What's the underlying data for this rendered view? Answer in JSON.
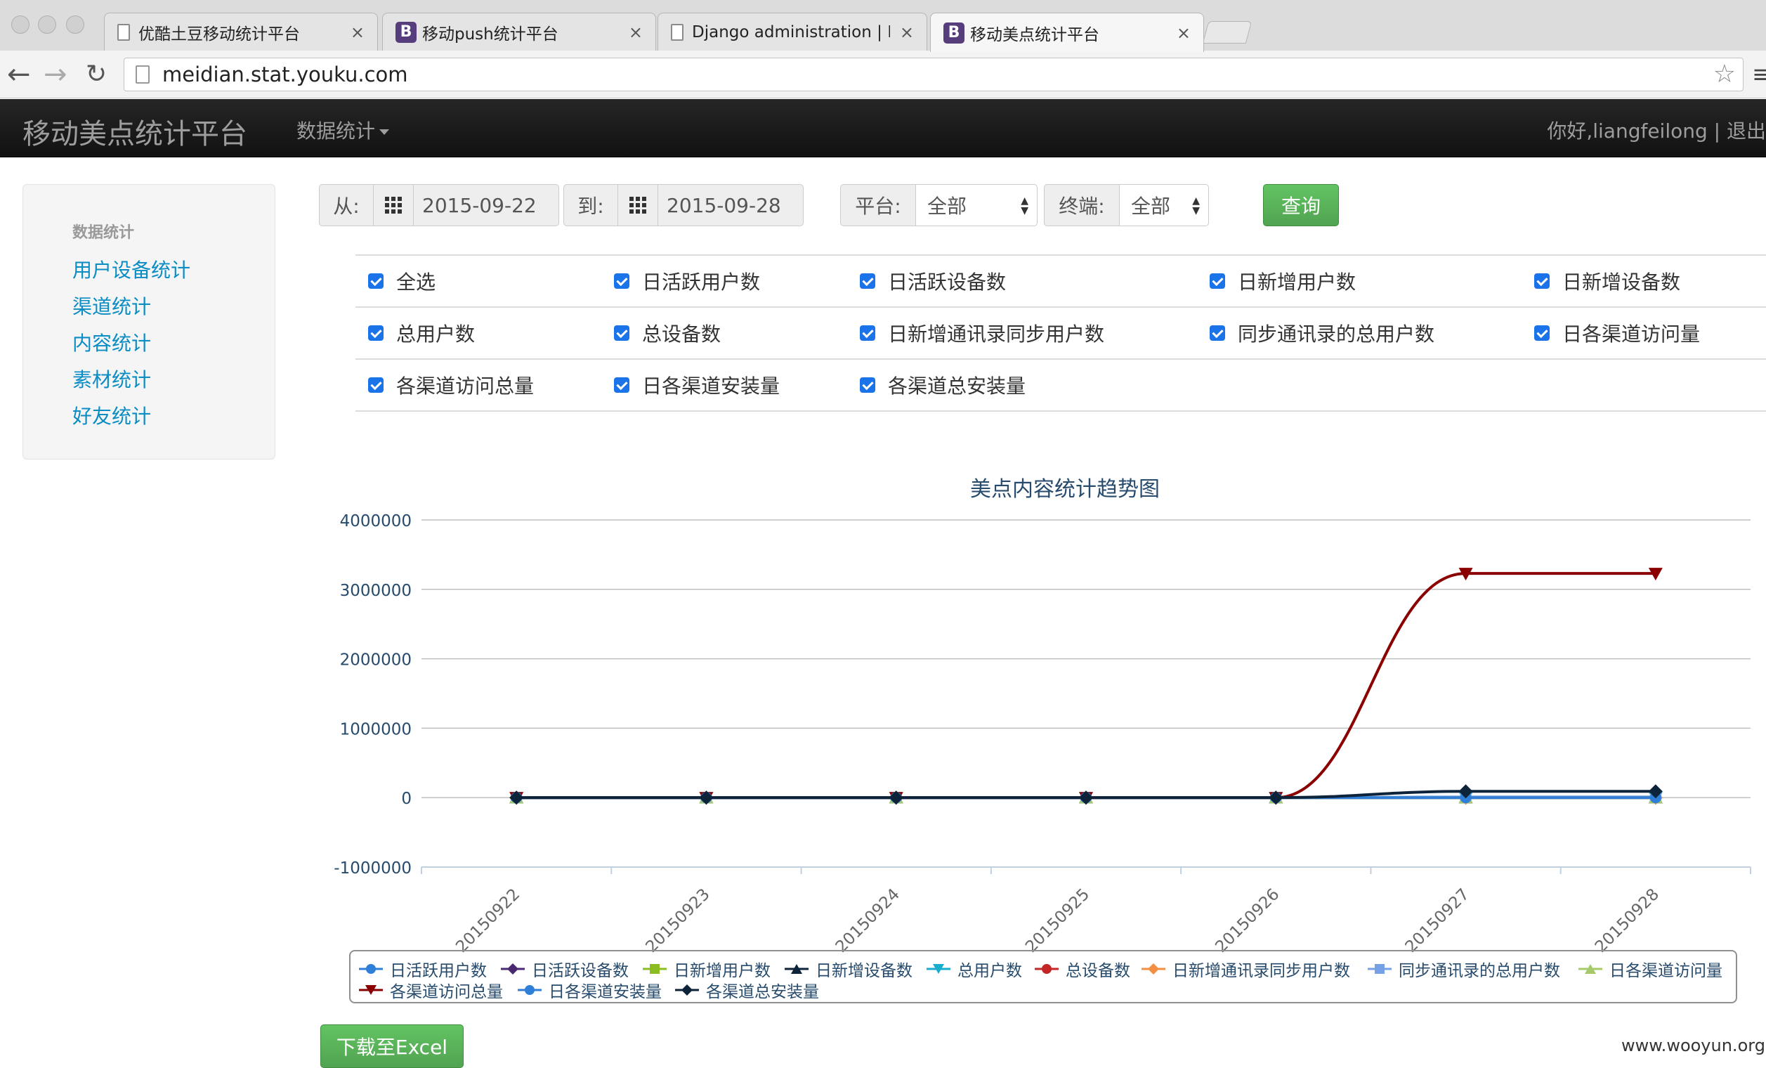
{
  "browser": {
    "tabs": [
      {
        "title": "优酷土豆移动统计平台",
        "icon": "page-icon"
      },
      {
        "title": "移动push统计平台",
        "icon": "bootstrap-icon"
      },
      {
        "title": "Django administration | Dja",
        "icon": "page-icon"
      },
      {
        "title": "移动美点统计平台",
        "icon": "bootstrap-icon"
      }
    ],
    "url": "meidian.stat.youku.com"
  },
  "navbar": {
    "brand": "移动美点统计平台",
    "menu_label": "数据统计",
    "user_text": "你好,liangfeilong | 退出"
  },
  "sidebar": {
    "header": "数据统计",
    "items": [
      "用户设备统计",
      "渠道统计",
      "内容统计",
      "素材统计",
      "好友统计"
    ]
  },
  "filters": {
    "from_label": "从:",
    "from_value": "2015-09-22",
    "to_label": "到:",
    "to_value": "2015-09-28",
    "platform_label": "平台:",
    "platform_value": "全部",
    "terminal_label": "终端:",
    "terminal_value": "全部",
    "query_button": "查询"
  },
  "checkboxes": [
    "全选",
    "日活跃用户数",
    "日活跃设备数",
    "日新增用户数",
    "日新增设备数",
    "总用户数",
    "总设备数",
    "日新增通讯录同步用户数",
    "同步通讯录的总用户数",
    "日各渠道访问量",
    "各渠道访问总量",
    "日各渠道安装量",
    "各渠道总安装量"
  ],
  "chart_data": {
    "type": "line",
    "title": "美点内容统计趋势图",
    "xlabel": "",
    "ylabel": "",
    "categories": [
      "20150922",
      "20150923",
      "20150924",
      "20150925",
      "20150926",
      "20150927",
      "20150928"
    ],
    "ylim": [
      -1000000,
      4000000
    ],
    "yticks": [
      -1000000,
      0,
      1000000,
      2000000,
      3000000,
      4000000
    ],
    "grid": true,
    "legend_position": "bottom",
    "series": [
      {
        "name": "日活跃用户数",
        "color": "#2f7ed8",
        "marker": "circle",
        "values": [
          0,
          0,
          0,
          0,
          0,
          0,
          0
        ]
      },
      {
        "name": "日活跃设备数",
        "color": "#492970",
        "marker": "diamond",
        "values": [
          0,
          0,
          0,
          0,
          0,
          0,
          0
        ]
      },
      {
        "name": "日新增用户数",
        "color": "#8bbc21",
        "marker": "square",
        "values": [
          0,
          0,
          0,
          0,
          0,
          0,
          0
        ]
      },
      {
        "name": "日新增设备数",
        "color": "#0d233a",
        "marker": "triangle",
        "values": [
          0,
          0,
          0,
          0,
          0,
          0,
          0
        ]
      },
      {
        "name": "总用户数",
        "color": "#1aadce",
        "marker": "triangle-down",
        "values": [
          0,
          0,
          0,
          0,
          0,
          0,
          0
        ]
      },
      {
        "name": "总设备数",
        "color": "#c42525",
        "marker": "circle",
        "values": [
          0,
          0,
          0,
          0,
          0,
          0,
          0
        ]
      },
      {
        "name": "日新增通讯录同步用户数",
        "color": "#f28f43",
        "marker": "diamond",
        "values": [
          0,
          0,
          0,
          0,
          0,
          0,
          0
        ]
      },
      {
        "name": "同步通讯录的总用户数",
        "color": "#77a1e5",
        "marker": "square",
        "values": [
          0,
          0,
          0,
          0,
          0,
          10000,
          10000
        ]
      },
      {
        "name": "日各渠道访问量",
        "color": "#a6c96a",
        "marker": "triangle",
        "values": [
          0,
          0,
          0,
          0,
          0,
          0,
          0
        ]
      },
      {
        "name": "各渠道访问总量",
        "color": "#8b0000",
        "marker": "triangle-down",
        "values": [
          0,
          0,
          0,
          0,
          0,
          3230000,
          3230000
        ]
      },
      {
        "name": "日各渠道安装量",
        "color": "#2f7ed8",
        "marker": "circle",
        "values": [
          0,
          0,
          0,
          0,
          0,
          0,
          0
        ]
      },
      {
        "name": "各渠道总安装量",
        "color": "#0d233a",
        "marker": "diamond",
        "values": [
          0,
          0,
          0,
          0,
          0,
          90000,
          90000
        ]
      }
    ]
  },
  "download_button": "下载至Excel",
  "watermark": "www.wooyun.org"
}
